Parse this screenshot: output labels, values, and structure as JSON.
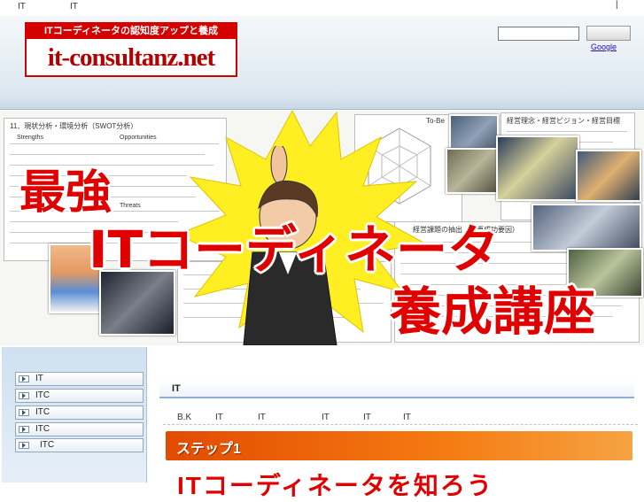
{
  "topbar": {
    "left_text_1": "IT",
    "left_text_2": "IT"
  },
  "logo": {
    "tagline": "ITコーディネータの認知度アップと養成",
    "site_name": "it-consultanz.net"
  },
  "search": {
    "placeholder": "",
    "button_label": "",
    "separator": "|",
    "google_label": "Google"
  },
  "banner": {
    "title_line1": "最強",
    "title_line2": "ITコーディネータ",
    "title_line3": "養成講座",
    "doc_heading": "11．現状分析・環境分析（SWOT分析）",
    "doc_swot_s": "Strengths",
    "doc_swot_o": "Opportunities",
    "doc_swot_t": "Threats",
    "doc_right_title": "経営理念・経営ビジョン・経営目標",
    "doc_tobe": "To-Be",
    "doc_mid_title": "経営課題の抽出（重要成功要因）"
  },
  "sidebar": {
    "items": [
      {
        "label": "IT"
      },
      {
        "label": "ITC"
      },
      {
        "label": "ITC"
      },
      {
        "label": "ITC"
      },
      {
        "label": "ITC"
      }
    ]
  },
  "main": {
    "section_title": "IT",
    "nav": [
      "B.K",
      "IT",
      "IT",
      "IT",
      "IT",
      "IT"
    ],
    "step_label": "ステップ1",
    "step_heading": "ITコーディネータを知ろう"
  },
  "colors": {
    "accent_red": "#e00000",
    "step_orange": "#f57b12",
    "sidebar_blue": "#cfe0f0"
  }
}
